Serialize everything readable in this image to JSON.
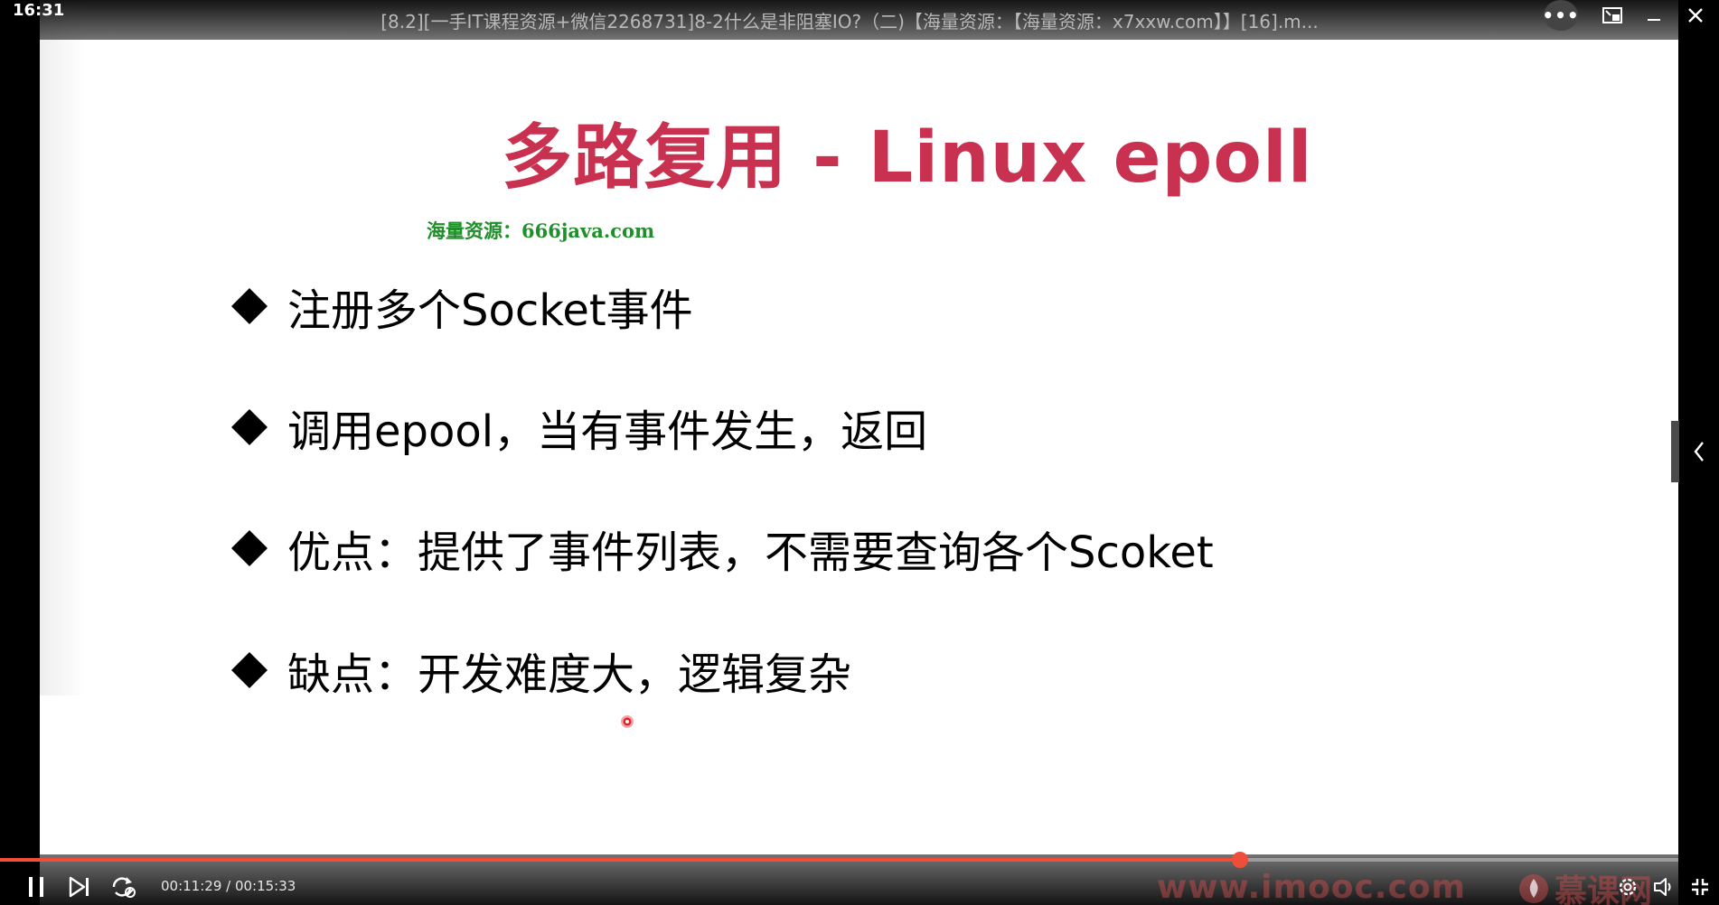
{
  "status": {
    "clock": "16:31"
  },
  "window": {
    "title": "[8.2][一手IT课程资源+微信2268731]8-2什么是非阻塞IO?（二)【海量资源：【海量资源：x7xxw.com】】[16].m...",
    "more_label": "•••"
  },
  "slide": {
    "title": "多路复用 - Linux epoll",
    "watermark": "海量资源：666java.com",
    "bullets": [
      {
        "text": "注册多个Socket事件"
      },
      {
        "text": "调用epool，当有事件发生，返回"
      },
      {
        "text": "优点：提供了事件列表，不需要查询各个Scoket"
      },
      {
        "text": "缺点：开发难度大，逻辑复杂"
      }
    ]
  },
  "player": {
    "current_time": "00:11:29",
    "total_time": "00:15:33",
    "time_display": "00:11:29 / 00:15:33",
    "progress_fraction": 0.7388,
    "accent_color": "#f04d3a",
    "brand_watermark": "www.imooc.com",
    "brand_logo_text": "慕课网"
  },
  "icons": {
    "more": "more-dots-icon",
    "pip": "picture-in-picture-icon",
    "minimize": "minimize-icon",
    "close": "close-icon",
    "side_expand": "chevron-left-icon",
    "pause": "pause-icon",
    "next": "skip-next-icon",
    "loop": "loop-icon",
    "settings": "gear-icon",
    "volume": "volume-icon",
    "fullscreen": "exit-fullscreen-icon"
  }
}
